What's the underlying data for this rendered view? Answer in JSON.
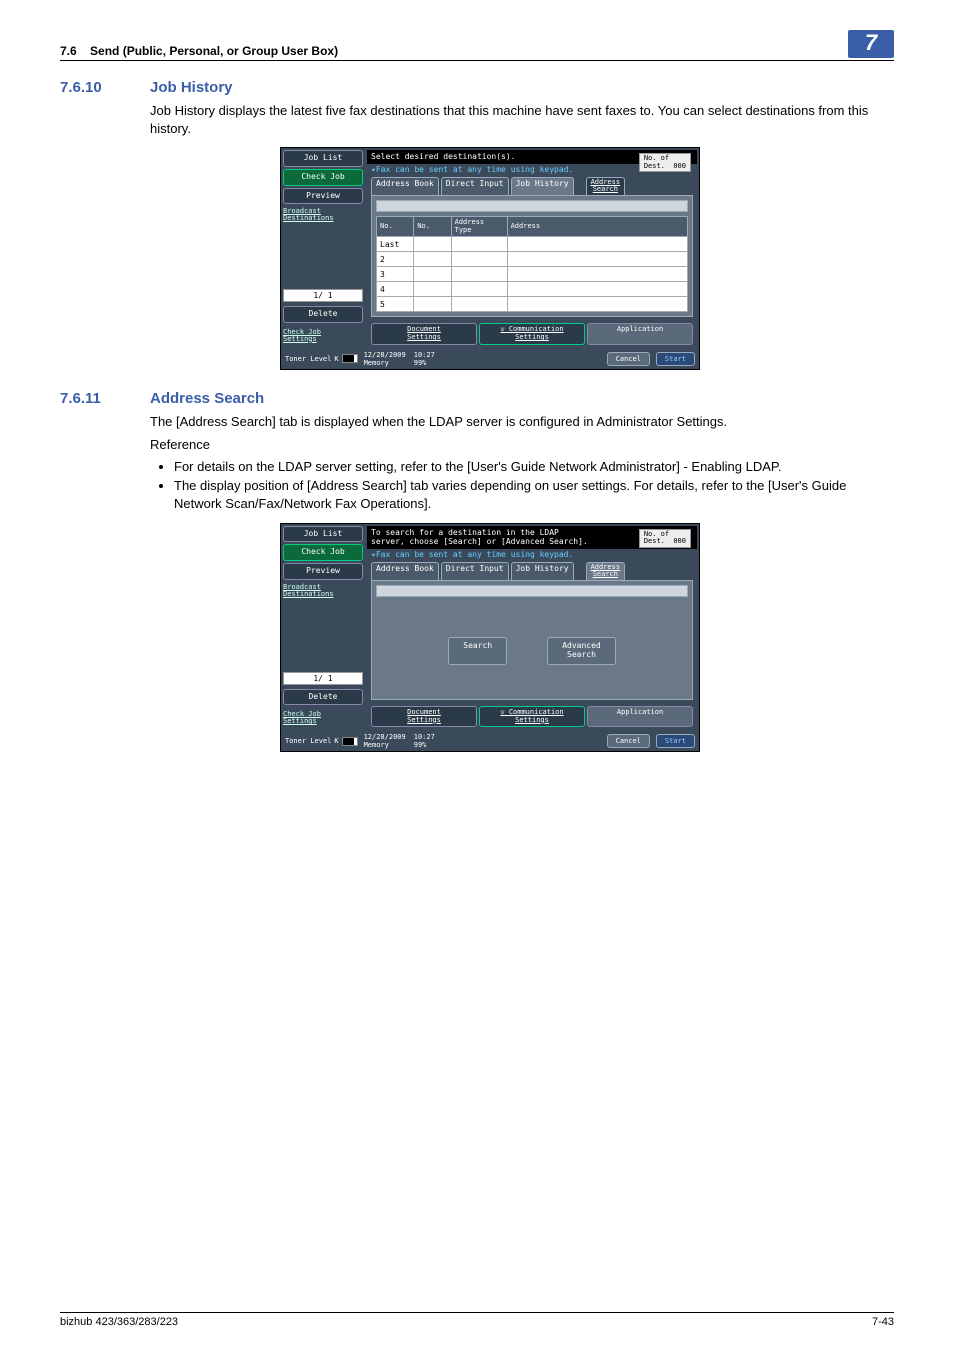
{
  "header": {
    "section_ref": "7.6",
    "section_title": "Send (Public, Personal, or Group User Box)",
    "chapter_badge": "7"
  },
  "sec1": {
    "num": "7.6.10",
    "title": "Job History",
    "para": "Job History displays the latest five fax destinations that this machine have sent faxes to. You can select destinations from this history."
  },
  "sec2": {
    "num": "7.6.11",
    "title": "Address Search",
    "para": "The [Address Search] tab is displayed when the LDAP server is configured in Administrator Settings.",
    "ref": "Reference",
    "bul1": "For details on the LDAP server setting, refer to the [User's Guide Network Administrator] - Enabling LDAP.",
    "bul2": "The display position of [Address Search] tab varies depending on user settings. For details, refer to the [User's Guide Network Scan/Fax/Network Fax Operations]."
  },
  "shot_common": {
    "side_joblist": "Job List",
    "side_checkjob": "Check Job",
    "side_preview": "Preview",
    "side_broadcast": "Broadcast\nDestinations",
    "page_ind": "1/  1",
    "side_delete": "Delete",
    "side_checkjobset": "Check Job\nSettings",
    "side_toner": "Toner Level",
    "tab_addrbook": "Address Book",
    "tab_direct": "Direct Input",
    "tab_jobhist": "Job History",
    "tab_addrsearch": "Address\nSearch",
    "hint": "Fax can be sent at any time using keypad.",
    "noof_label": "No. of\nDest.",
    "noof_val": "000",
    "bot_doc": "Document\nSettings",
    "bot_comm": "Communication\nSettings",
    "bot_app": "Application",
    "btn_cancel": "Cancel",
    "btn_start": "Start",
    "status_date": "12/28/2009",
    "status_time": "10:27",
    "status_mem_label": "Memory",
    "status_mem_val": "99%"
  },
  "shot1": {
    "instruction": "Select desired destination(s).",
    "col_no1": "No.",
    "col_no2": "No.",
    "col_addrtype": "Address\nType",
    "col_address": "Address",
    "row1": "Last",
    "row2": "2",
    "row3": "3",
    "row4": "4",
    "row5": "5"
  },
  "shot2": {
    "instruction1": "To search for a destination in the LDAP",
    "instruction2": "server, choose [Search] or [Advanced Search].",
    "btn_search": "Search",
    "btn_advsearch": "Advanced\nSearch"
  },
  "footer": {
    "left": "bizhub 423/363/283/223",
    "right": "7-43"
  }
}
